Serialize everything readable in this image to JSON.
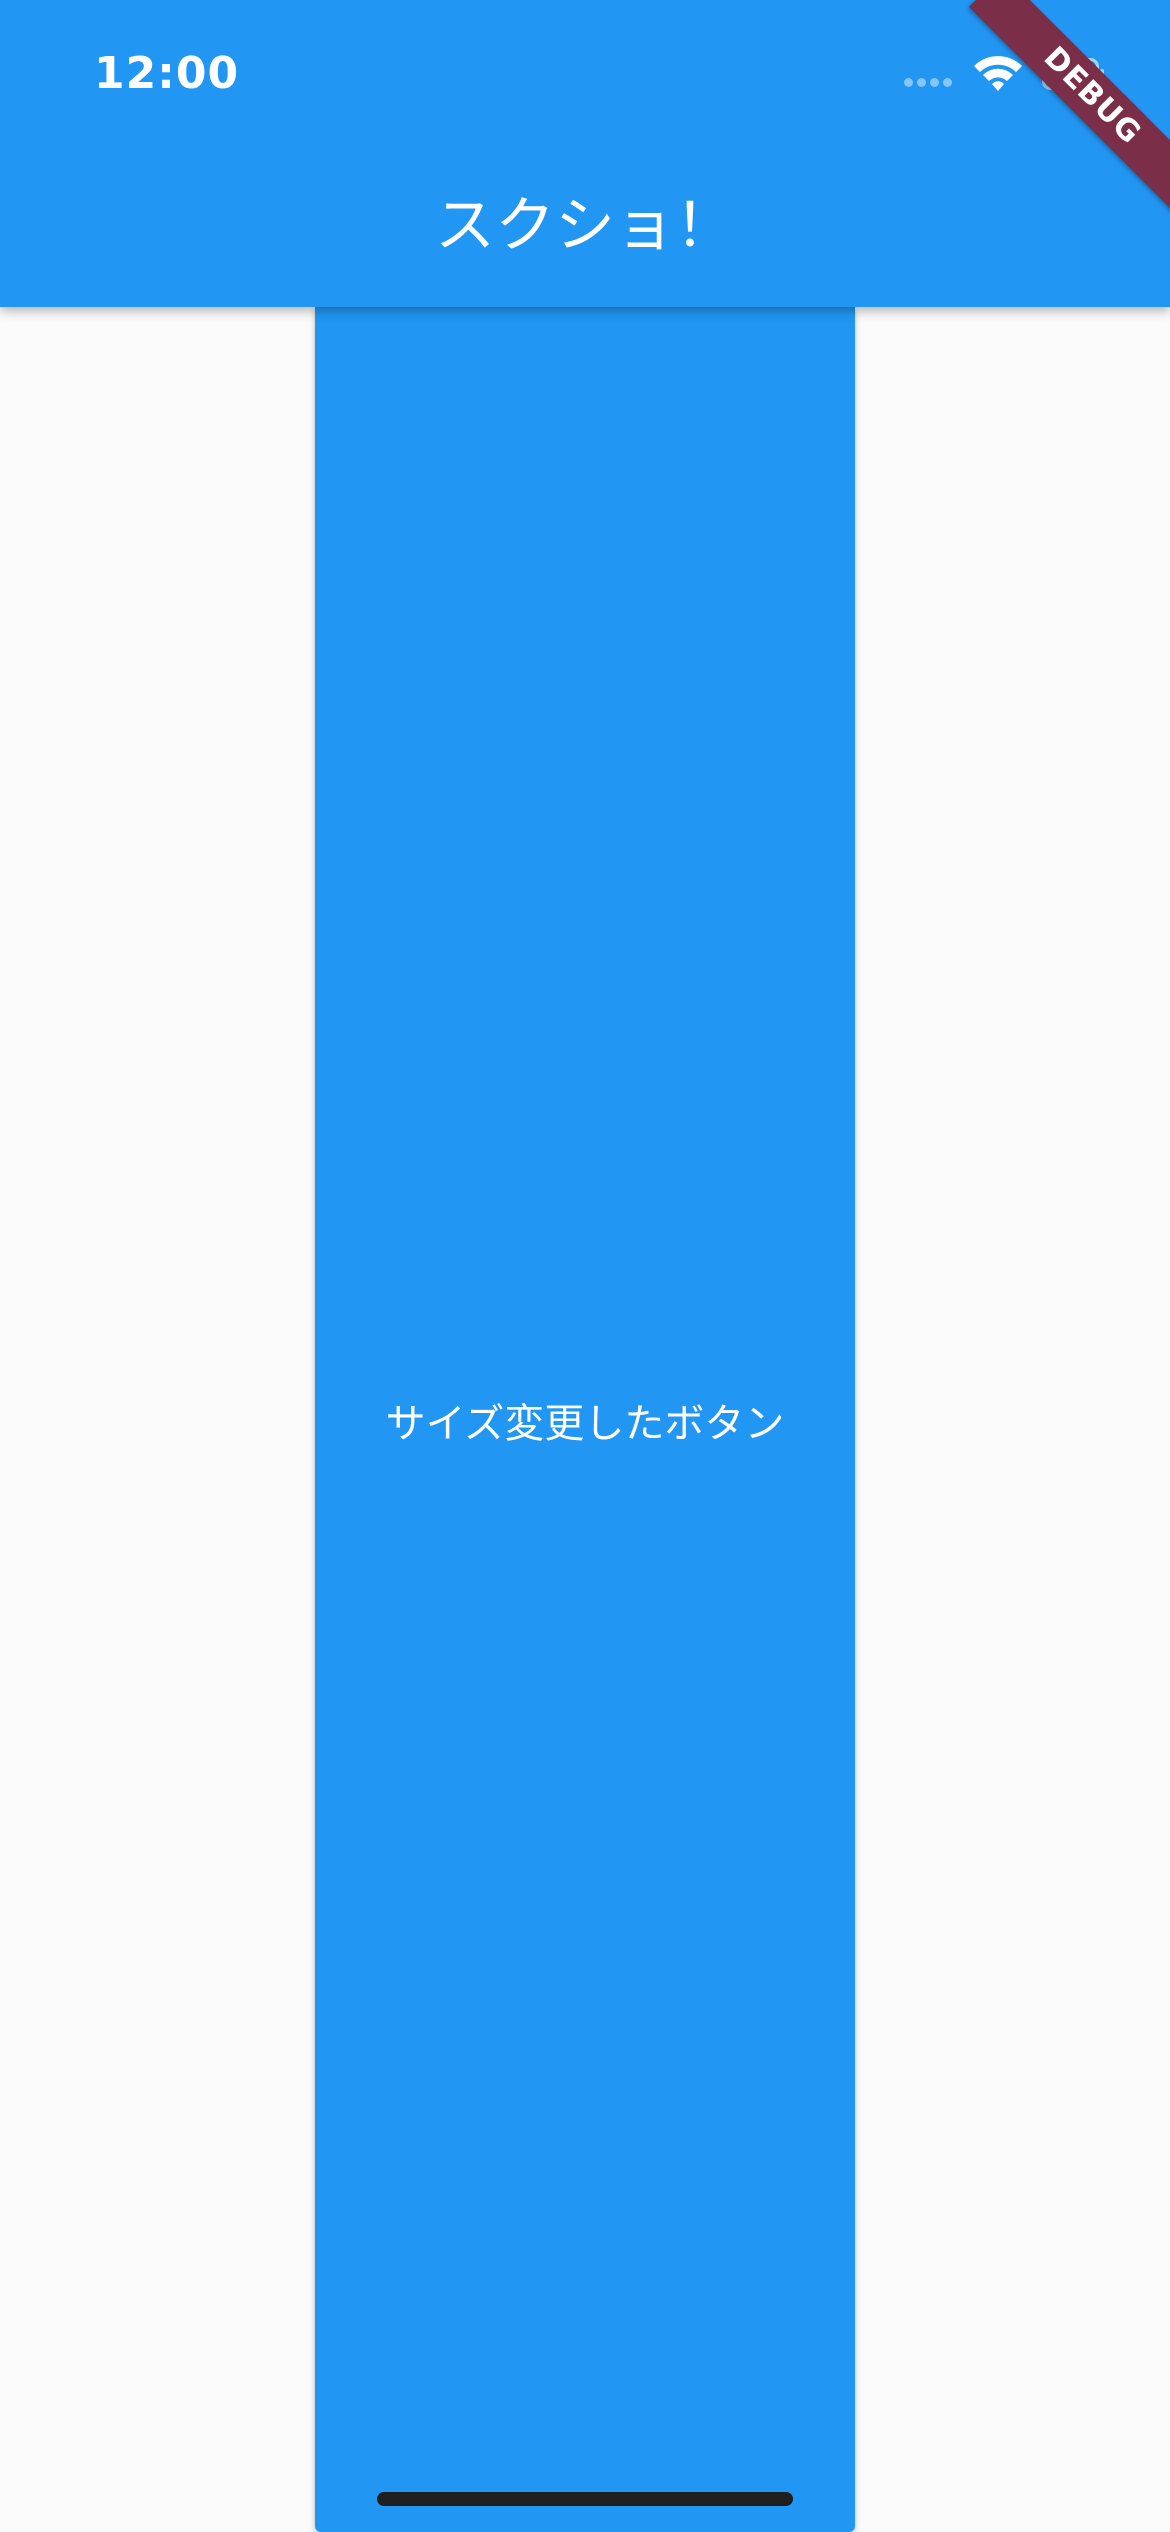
{
  "status_bar": {
    "time": "12:00"
  },
  "app_bar": {
    "title": "スクショ！",
    "background_color": "#2196F3"
  },
  "debug_banner": {
    "label": "DEBUG",
    "color": "#7A2E47"
  },
  "main": {
    "button_label": "サイズ変更したボタン",
    "button_color": "#2196F3",
    "background_color": "#FAFAFA"
  },
  "icons": {
    "wifi": "wifi-icon",
    "battery": "battery-icon",
    "signal": "signal-icon"
  }
}
